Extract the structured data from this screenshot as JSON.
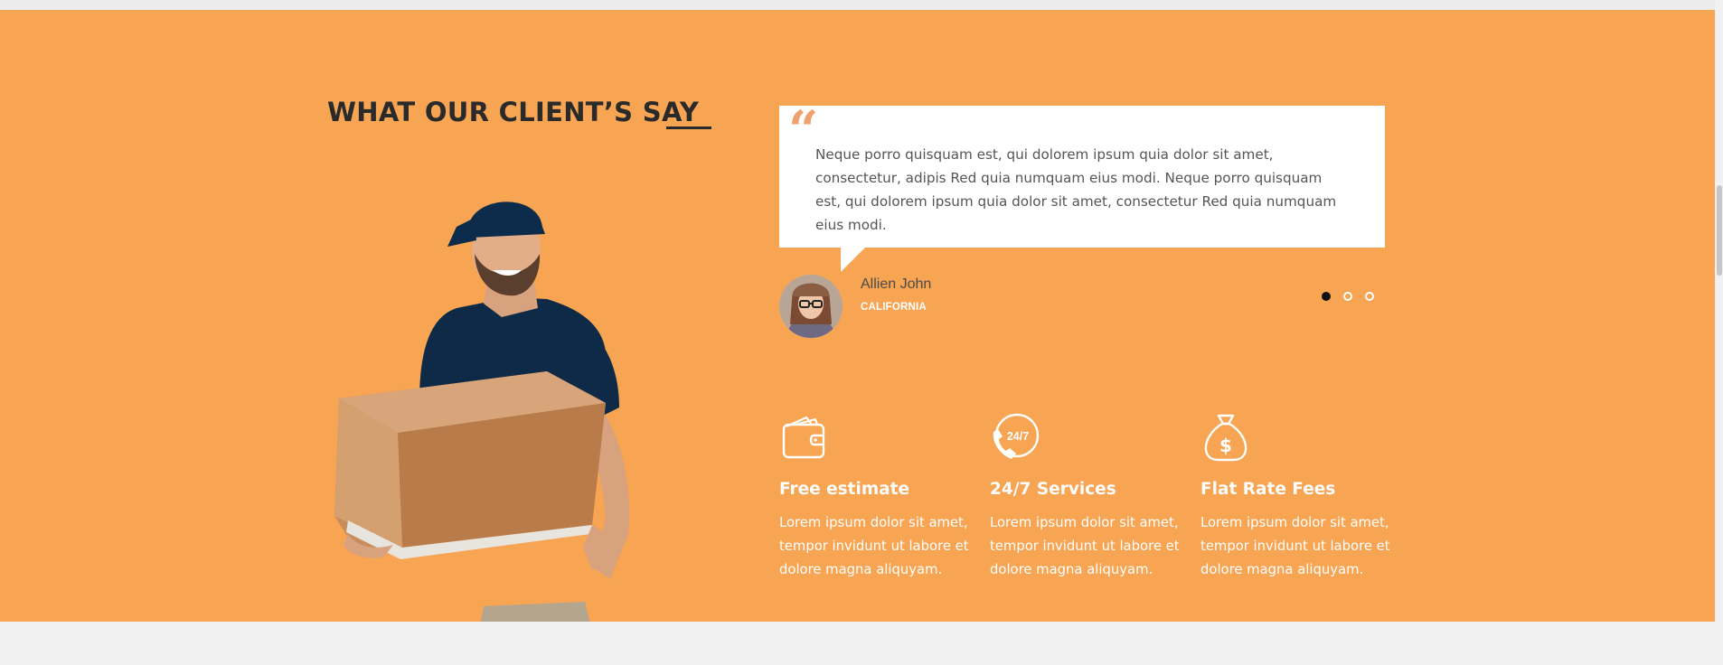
{
  "section": {
    "heading": "WHAT OUR CLIENT’S SAY"
  },
  "testimonial": {
    "quote_mark": "“",
    "text": "Neque porro quisquam est, qui dolorem ipsum quia dolor sit amet, consectetur, adipis Red quia numquam eius modi. Neque porro quisquam est, qui dolorem ipsum quia dolor sit amet, consectetur Red quia numquam eius modi.",
    "author_name": "Allien John",
    "author_location": "CALIFORNIA"
  },
  "carousel": {
    "total_slides": 3,
    "active_slide": 1
  },
  "features": [
    {
      "icon": "wallet-icon",
      "title": "Free estimate",
      "text": "Lorem ipsum dolor sit amet, tempor invidunt ut labore et dolore magna aliquyam."
    },
    {
      "icon": "phone-24-7-icon",
      "title": "24/7 Services",
      "text": "Lorem ipsum dolor sit amet, tempor invidunt ut labore et dolore magna aliquyam."
    },
    {
      "icon": "money-bag-icon",
      "title": "Flat Rate Fees",
      "text": "Lorem ipsum dolor sit amet, tempor invidunt ut labore et dolore magna aliquyam."
    }
  ],
  "icon_24_7_label": "24/7",
  "colors": {
    "section_bg": "#f7a453",
    "quote_mark": "#f0a16d",
    "heading": "#2a2a2a",
    "dot_active": "#111111",
    "text_white": "#ffffff"
  }
}
